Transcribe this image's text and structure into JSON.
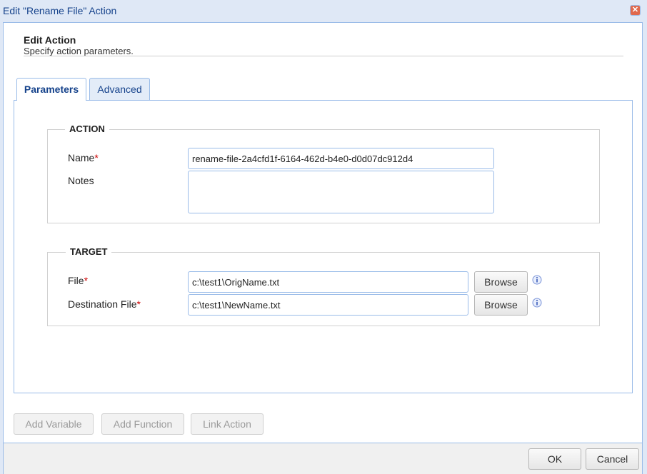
{
  "window": {
    "title": "Edit \"Rename File\" Action"
  },
  "header": {
    "title": "Edit Action",
    "subtitle": "Specify action parameters."
  },
  "tabs": [
    {
      "label": "Parameters",
      "active": true
    },
    {
      "label": "Advanced",
      "active": false
    }
  ],
  "action_group": {
    "legend": "ACTION",
    "name_label": "Name",
    "name_value": "rename-file-2a4cfd1f-6164-462d-b4e0-d0d07dc912d4",
    "notes_label": "Notes",
    "notes_value": ""
  },
  "target_group": {
    "legend": "TARGET",
    "file_label": "File",
    "file_value": "c:\\test1\\OrigName.txt",
    "dest_label": "Destination File",
    "dest_value": "c:\\test1\\NewName.txt",
    "browse_label": "Browse"
  },
  "required_marker": "*",
  "toolbar": {
    "add_variable": "Add Variable",
    "add_function": "Add Function",
    "link_action": "Link Action"
  },
  "footer": {
    "ok": "OK",
    "cancel": "Cancel"
  },
  "icons": {
    "close": "close-icon",
    "info": "info-icon"
  },
  "colors": {
    "accent": "#15428b",
    "border": "#99bbe8",
    "required": "#cc0000"
  }
}
